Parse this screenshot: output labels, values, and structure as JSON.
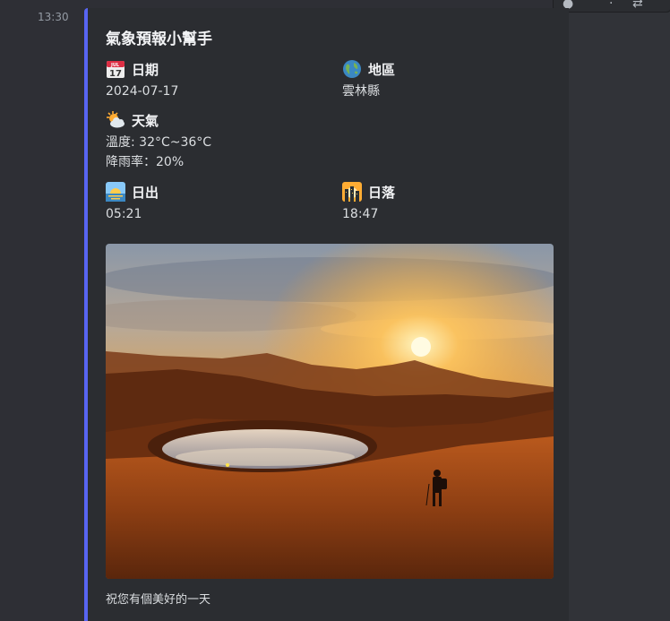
{
  "message": {
    "timestamp": "13:30"
  },
  "embed": {
    "title": "氣象預報小幫手",
    "date": {
      "label": "日期",
      "value": "2024-07-17",
      "icon": "calendar-icon",
      "calendar_month": "JUL",
      "calendar_day": "17"
    },
    "region": {
      "label": "地區",
      "value": "雲林縣",
      "icon": "globe-icon"
    },
    "weather": {
      "label": "天氣",
      "temperature": "溫度: 32°C~36°C",
      "rain": "降雨率：20%",
      "icon": "sun-behind-cloud-icon"
    },
    "sunrise": {
      "label": "日出",
      "value": "05:21",
      "icon": "sunrise-icon"
    },
    "sunset": {
      "label": "日落",
      "value": "18:47",
      "icon": "sunset-icon"
    },
    "image": {
      "subject": "sunset over mountain lake with hiker"
    },
    "footer": "祝您有個美好的一天",
    "accent_color": "#5865f2"
  }
}
